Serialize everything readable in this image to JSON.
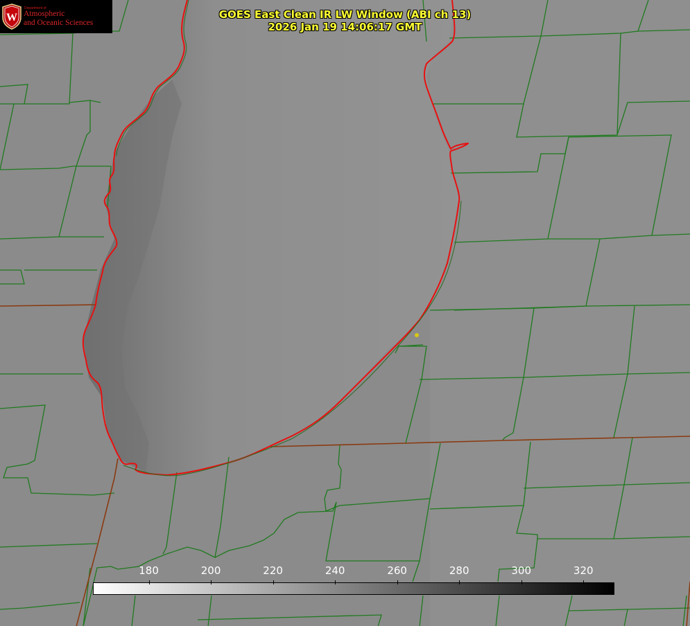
{
  "title": {
    "line1": "GOES East Clean IR LW Window (ABI ch 13)",
    "line2": "2026 Jan 19 14:06:17 GMT"
  },
  "logo": {
    "dept": "Department of",
    "line1": "Atmospheric",
    "line2": "and Oceanic Sciences",
    "crest_letter": "W"
  },
  "colorbar": {
    "ticks": [
      "180",
      "200",
      "220",
      "240",
      "260",
      "280",
      "300",
      "320"
    ],
    "range": [
      162,
      330
    ],
    "gradient": "white-to-black"
  },
  "colors": {
    "county_lines": "#1f7a1f",
    "state_lines": "#8a3a10",
    "coastline": "#ff0000",
    "title_text": "#ffff33",
    "background": "#8a8a8a",
    "lake": "#909090",
    "lake_cold_edge": "#6e6e6e"
  }
}
